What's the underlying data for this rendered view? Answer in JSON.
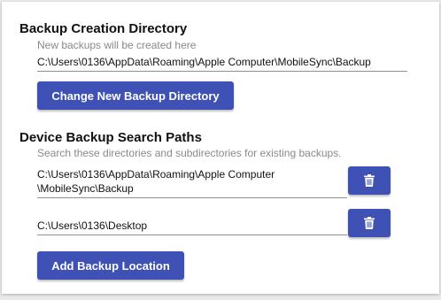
{
  "backup_creation": {
    "heading": "Backup Creation Directory",
    "subtitle": "New backups will be created here",
    "path": "C:\\Users\\0136\\AppData\\Roaming\\Apple Computer\\MobileSync\\Backup",
    "change_button_label": "Change New Backup Directory"
  },
  "search_paths": {
    "heading": "Device Backup Search Paths",
    "subtitle": "Search these directories and subdirectories for existing backups.",
    "paths": [
      {
        "line1": "C:\\Users\\0136\\AppData\\Roaming\\Apple Computer",
        "line2": "\\MobileSync\\Backup",
        "delete_icon": "trash-icon"
      },
      {
        "line1": "C:\\Users\\0136\\Desktop",
        "delete_icon": "trash-icon"
      }
    ],
    "add_button_label": "Add Backup Location"
  },
  "colors": {
    "accent": "#3f51b5"
  }
}
